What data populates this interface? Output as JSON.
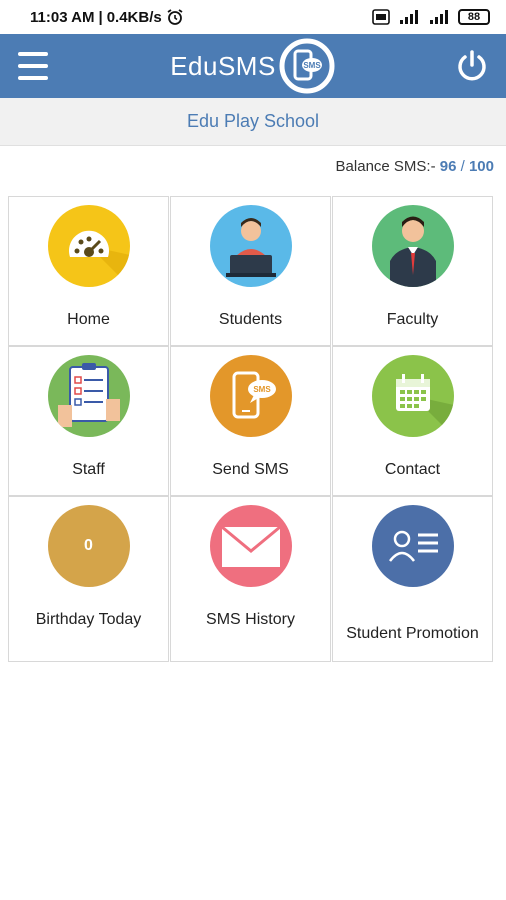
{
  "status_bar": {
    "time": "11:03 AM",
    "speed": "0.4KB/s",
    "battery": "88",
    "icons": [
      "alarm-icon",
      "volte-icon",
      "signal-icon",
      "signal-icon",
      "battery-icon"
    ]
  },
  "app_bar": {
    "brand": "EduSMS",
    "logo_badge": "SMS"
  },
  "school": {
    "name": "Edu Play School"
  },
  "balance": {
    "label": "Balance SMS:-",
    "used": "96",
    "separator": "/",
    "total": "100"
  },
  "tiles": [
    {
      "label": "Home",
      "icon": "dashboard-icon",
      "color": "#f5c518"
    },
    {
      "label": "Students",
      "icon": "student-icon",
      "color": "#5ab9e8"
    },
    {
      "label": "Faculty",
      "icon": "faculty-icon",
      "color": "#5dbb7a"
    },
    {
      "label": "Staff",
      "icon": "checklist-icon",
      "color": "#7ab85a"
    },
    {
      "label": "Send SMS",
      "icon": "send-sms-icon",
      "color": "#e3972a"
    },
    {
      "label": "Contact",
      "icon": "calendar-icon",
      "color": "#8bc34a"
    },
    {
      "label": "Birthday Today",
      "icon": "birthday-icon",
      "color": "#d4a44a",
      "count": "0"
    },
    {
      "label": "SMS History",
      "icon": "envelope-icon",
      "color": "#ef6f7f"
    },
    {
      "label": "Student Promotion",
      "icon": "id-card-icon",
      "color": "#4c6fa8"
    }
  ],
  "colors": {
    "primary": "#4c7cb4",
    "school_bar": "#f1f1f1"
  }
}
